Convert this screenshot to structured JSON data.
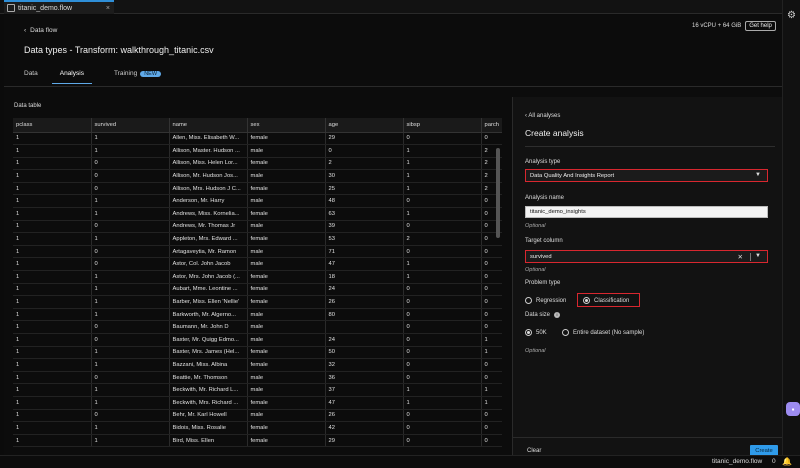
{
  "tab": {
    "title": "titanic_demo.flow",
    "close": "×"
  },
  "header": {
    "back_label": "Data flow",
    "page_title": "Data types - Transform: walkthrough_titanic.csv",
    "instance": "16 vCPU + 64 GiB",
    "help": "Get help"
  },
  "tabs": [
    {
      "label": "Data"
    },
    {
      "label": "Analysis"
    },
    {
      "label": "Training",
      "badge": "NEW"
    }
  ],
  "data_table": {
    "label": "Data table",
    "columns": [
      "pclass",
      "survived",
      "name",
      "sex",
      "age",
      "sibsp",
      "parch"
    ],
    "rows": [
      [
        "1",
        "1",
        "Allen, Miss. Elisabeth W...",
        "female",
        "29",
        "0",
        "0"
      ],
      [
        "1",
        "1",
        "Allison, Master. Hudson ...",
        "male",
        "0",
        "1",
        "2"
      ],
      [
        "1",
        "0",
        "Allison, Miss. Helen Lor...",
        "female",
        "2",
        "1",
        "2"
      ],
      [
        "1",
        "0",
        "Allison, Mr. Hudson Jos...",
        "male",
        "30",
        "1",
        "2"
      ],
      [
        "1",
        "0",
        "Allison, Mrs. Hudson J C...",
        "female",
        "25",
        "1",
        "2"
      ],
      [
        "1",
        "1",
        "Anderson, Mr. Harry",
        "male",
        "48",
        "0",
        "0"
      ],
      [
        "1",
        "1",
        "Andrews, Miss. Kornelia...",
        "female",
        "63",
        "1",
        "0"
      ],
      [
        "1",
        "0",
        "Andrews, Mr. Thomas Jr",
        "male",
        "39",
        "0",
        "0"
      ],
      [
        "1",
        "1",
        "Appleton, Mrs. Edward ...",
        "female",
        "53",
        "2",
        "0"
      ],
      [
        "1",
        "0",
        "Artagaveytia, Mr. Ramon",
        "male",
        "71",
        "0",
        "0"
      ],
      [
        "1",
        "0",
        "Astor, Col. John Jacob",
        "male",
        "47",
        "1",
        "0"
      ],
      [
        "1",
        "1",
        "Astor, Mrs. John Jacob (...",
        "female",
        "18",
        "1",
        "0"
      ],
      [
        "1",
        "1",
        "Aubart, Mme. Leontine ...",
        "female",
        "24",
        "0",
        "0"
      ],
      [
        "1",
        "1",
        "Barber, Miss. Ellen 'Nellie'",
        "female",
        "26",
        "0",
        "0"
      ],
      [
        "1",
        "1",
        "Barkworth, Mr. Algerno...",
        "male",
        "80",
        "0",
        "0"
      ],
      [
        "1",
        "0",
        "Baumann, Mr. John D",
        "male",
        "",
        "0",
        "0"
      ],
      [
        "1",
        "0",
        "Baxter, Mr. Quigg Edmo...",
        "male",
        "24",
        "0",
        "1"
      ],
      [
        "1",
        "1",
        "Baxter, Mrs. James (Hel...",
        "female",
        "50",
        "0",
        "1"
      ],
      [
        "1",
        "1",
        "Bazzani, Miss. Albina",
        "female",
        "32",
        "0",
        "0"
      ],
      [
        "1",
        "0",
        "Beattie, Mr. Thomson",
        "male",
        "36",
        "0",
        "0"
      ],
      [
        "1",
        "1",
        "Beckwith, Mr. Richard L...",
        "male",
        "37",
        "1",
        "1"
      ],
      [
        "1",
        "1",
        "Beckwith, Mrs. Richard ...",
        "female",
        "47",
        "1",
        "1"
      ],
      [
        "1",
        "0",
        "Behr, Mr. Karl Howell",
        "male",
        "26",
        "0",
        "0"
      ],
      [
        "1",
        "1",
        "Bidois, Miss. Rosalie",
        "female",
        "42",
        "0",
        "0"
      ],
      [
        "1",
        "1",
        "Bird, Miss. Ellen",
        "female",
        "29",
        "0",
        "0"
      ]
    ]
  },
  "panel": {
    "back_label": "All analyses",
    "title": "Create analysis",
    "analysis_type_label": "Analysis type",
    "analysis_type_value": "Data Quality And Insights Report",
    "analysis_name_label": "Analysis name",
    "analysis_name_value": "titanic_demo_insights",
    "optional": "Optional",
    "target_label": "Target column",
    "target_value": "survived",
    "problem_type_label": "Problem type",
    "regression": "Regression",
    "classification": "Classification",
    "data_size_label": "Data size",
    "size_50k": "50K",
    "size_full": "Entire dataset (No sample)",
    "clear": "Clear",
    "create": "Create"
  },
  "statusbar": {
    "file": "titanic_demo.flow",
    "count": "0"
  }
}
